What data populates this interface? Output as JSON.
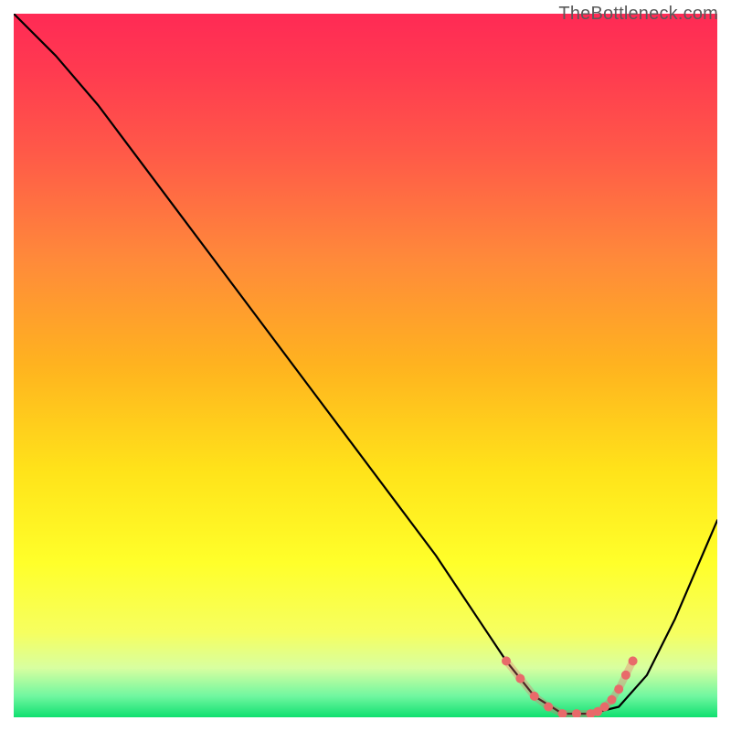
{
  "watermark": "TheBottleneck.com",
  "chart_data": {
    "type": "line",
    "title": "",
    "xlabel": "",
    "ylabel": "",
    "xlim": [
      0,
      100
    ],
    "ylim": [
      0,
      100
    ],
    "series": [
      {
        "name": "curve",
        "x": [
          0,
          6,
          12,
          18,
          24,
          30,
          36,
          42,
          48,
          54,
          60,
          66,
          70,
          74,
          78,
          82,
          86,
          90,
          94,
          100
        ],
        "y": [
          100,
          94,
          87,
          79,
          71,
          63,
          55,
          47,
          39,
          31,
          23,
          14,
          8,
          3,
          0.5,
          0.5,
          1.5,
          6,
          14,
          28
        ]
      },
      {
        "name": "highlight",
        "x": [
          70,
          72,
          74,
          76,
          78,
          80,
          82,
          83,
          84,
          85,
          86,
          87,
          88
        ],
        "y": [
          8,
          5.5,
          3,
          1.5,
          0.5,
          0.5,
          0.5,
          0.8,
          1.5,
          2.5,
          4,
          6,
          8
        ]
      }
    ],
    "background_gradient_stops": [
      {
        "offset": 0,
        "color": "#ff2a55"
      },
      {
        "offset": 8,
        "color": "#ff3a50"
      },
      {
        "offset": 20,
        "color": "#ff5a48"
      },
      {
        "offset": 35,
        "color": "#ff8a3a"
      },
      {
        "offset": 50,
        "color": "#ffb31f"
      },
      {
        "offset": 65,
        "color": "#ffe31a"
      },
      {
        "offset": 78,
        "color": "#ffff2a"
      },
      {
        "offset": 88,
        "color": "#f6ff60"
      },
      {
        "offset": 93,
        "color": "#d8ffa0"
      },
      {
        "offset": 97,
        "color": "#70f7a0"
      },
      {
        "offset": 100,
        "color": "#10e070"
      }
    ],
    "highlight_color": "#e86a6a",
    "curve_color": "#000000"
  }
}
